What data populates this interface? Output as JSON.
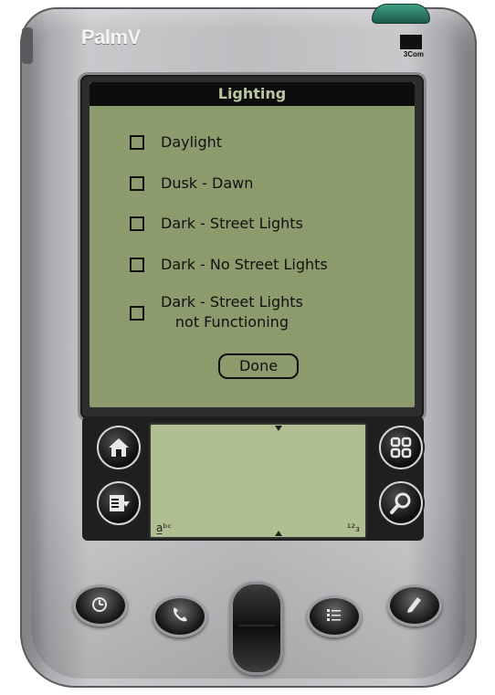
{
  "device": {
    "brand": "PalmV",
    "logo_text": "3Com"
  },
  "screen": {
    "title": "Lighting",
    "options": [
      {
        "label": "Daylight",
        "checked": false
      },
      {
        "label": "Dusk - Dawn",
        "checked": false
      },
      {
        "label": "Dark - Street Lights",
        "checked": false
      },
      {
        "label": "Dark - No Street Lights",
        "checked": false
      },
      {
        "label_line1": "Dark - Street Lights",
        "label_line2": "not Functioning",
        "checked": false
      }
    ],
    "done_label": "Done"
  },
  "silkscreen": {
    "icons": [
      "home-icon",
      "menu-icon",
      "applications-icon",
      "find-icon"
    ],
    "graffiti_corner_left": "a̲ᵇᶜ",
    "graffiti_corner_right": "¹²₃"
  },
  "hardware_buttons": [
    "calendar-icon",
    "phone-icon",
    "todo-icon",
    "memo-icon"
  ],
  "colors": {
    "screen_bg": "#8a9a6a",
    "title_bar": "#0d0d0d",
    "title_text": "#b9c6a0",
    "device_body": "#bdbdc0"
  }
}
